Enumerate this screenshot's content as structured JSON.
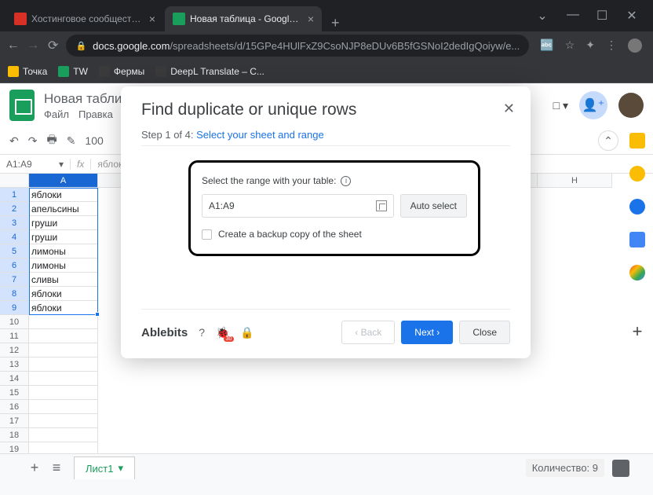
{
  "browser": {
    "tabs": [
      {
        "title": "Хостинговое сообщество «Time",
        "icon_color": "#d93025"
      },
      {
        "title": "Новая таблица - Google Таблиц",
        "icon_color": "#1a9e5c"
      }
    ],
    "url_domain": "docs.google.com",
    "url_path": "/spreadsheets/d/15GPe4HUlFxZ9CsoNJP8eDUv6B5fGSNoI2dedIgQoiyw/e...",
    "bookmarks": [
      {
        "label": "Точка",
        "color": "#fbbc04"
      },
      {
        "label": "TW",
        "color": "#1a9e5c"
      },
      {
        "label": "Фермы",
        "color": "#5f6368"
      },
      {
        "label": "DeepL Translate – C...",
        "color": "#5f6368"
      }
    ]
  },
  "doc": {
    "title": "Новая таблица",
    "menu": [
      "Файл",
      "Правка"
    ]
  },
  "toolbar": {
    "zoom": "100"
  },
  "namebox": {
    "ref": "A1:A9",
    "formula": "яблоки"
  },
  "columns": [
    "A",
    "H"
  ],
  "rows": [
    "яблоки",
    "апельсины",
    "груши",
    "груши",
    "лимоны",
    "лимоны",
    "сливы",
    "яблоки",
    "яблоки"
  ],
  "sheet_tab": "Лист1",
  "status": {
    "count_label": "Количество: 9"
  },
  "modal": {
    "title": "Find duplicate or unique rows",
    "step_prefix": "Step 1 of 4: ",
    "step_link": "Select your sheet and range",
    "range_label": "Select the range with your table:",
    "range_value": "A1:A9",
    "auto_select": "Auto select",
    "backup_label": "Create a backup copy of the sheet",
    "brand": "Ablebits",
    "back": "‹ Back",
    "next": "Next ›",
    "close": "Close"
  },
  "side_icons": [
    "#fbbc04",
    "#1a73e8",
    "#34a853",
    "#4285f4",
    "#ea4335"
  ]
}
